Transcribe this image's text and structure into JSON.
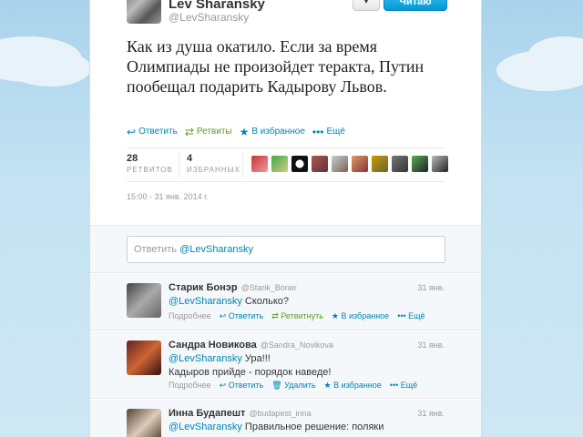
{
  "tweet": {
    "author_name": "Lev Sharansky",
    "author_handle": "@LevSharansky",
    "follow_dropdown": "▾",
    "follow_button": "Читаю",
    "text": "Как из душа окатило. Если за время Олимпиады не произойдет теракта, Путин пообещал подарить Кадырову Львов.",
    "actions": {
      "reply": "Ответить",
      "retweet": "Ретвиты",
      "favorite": "В избранное",
      "more": "Ещё"
    },
    "stats": {
      "retweets_count": "28",
      "retweets_label": "РЕТВИТОВ",
      "favorites_count": "4",
      "favorites_label": "ИЗБРАННЫХ"
    },
    "timestamp": "15:00 - 31 янв. 2014 г."
  },
  "reply_box": {
    "prefix": "Ответить ",
    "mention": "@LevSharansky"
  },
  "replies": [
    {
      "name": "Старик Бонэр",
      "handle": "@Starik_Boner",
      "date": "31 янв.",
      "mention": "@LevSharansky",
      "text": " Сколько?",
      "line2": "",
      "expand": "Подробнее",
      "reply": "Ответить",
      "retweet": "Ретвитнуть",
      "favorite": "В избранное",
      "more": "Ещё"
    },
    {
      "name": "Сандра Новикова",
      "handle": "@Sandra_Novikova",
      "date": "31 янв.",
      "mention": "@LevSharansky",
      "text": " Ура!!!",
      "line2": "Кадыров  прийде   - порядок  наведе!",
      "expand": "Подробнее",
      "reply": "Ответить",
      "delete": "Удалить",
      "favorite": "В избранное",
      "more": "Ещё"
    },
    {
      "name": "Инна Будапешт",
      "handle": "@budapest_inna",
      "date": "31 янв.",
      "mention": "@LevSharansky",
      "text": " Правильное решение: поляки",
      "line2": ""
    }
  ],
  "colors": {
    "link": "#0084b4",
    "retweet_green": "#609928",
    "follow_blue": "#019ad2",
    "background": "#c0deed"
  }
}
